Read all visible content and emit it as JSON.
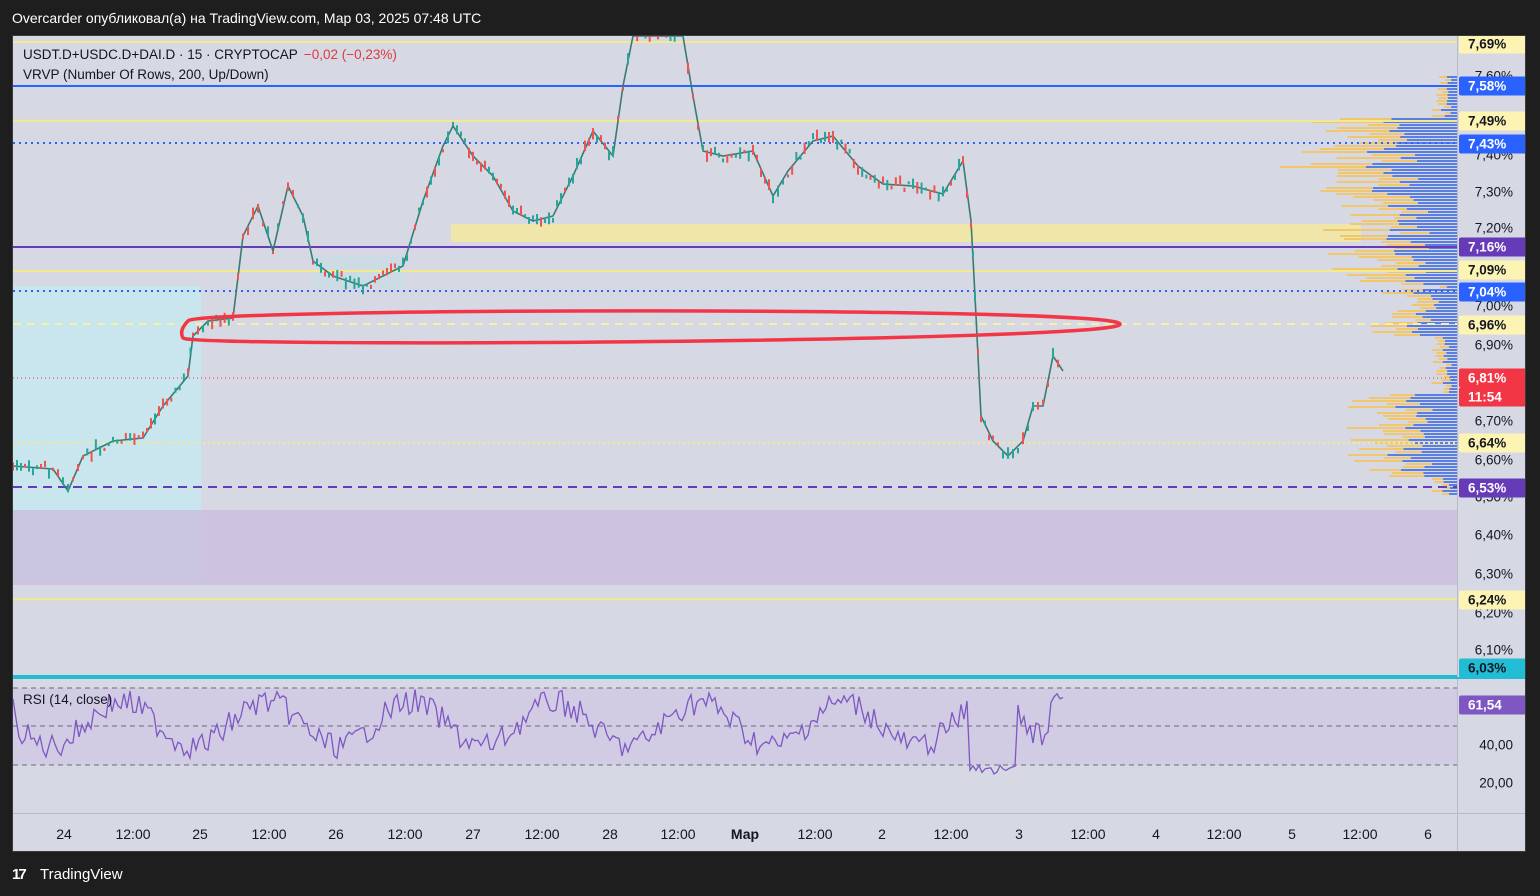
{
  "header": {
    "text": "Overcarder опубликовал(а) на TradingView.com, Мар 03, 2025 07:48 UTC"
  },
  "legend": {
    "symbol": "USDT.D+USDC.D+DAI.D · 15 · CRYPTOCAP",
    "change": "−0,02 (−0,23%)",
    "indicator": "VRVP (Number Of Rows, 200, Up/Down)"
  },
  "rsi": {
    "legend": "RSI (14, close)",
    "value": "61,54",
    "levels": [
      70,
      50,
      30
    ],
    "axis_ticks": [
      "40,00",
      "20,00"
    ]
  },
  "price_axis": {
    "ticks": [
      "7,60%",
      "7,50%",
      "7,40%",
      "7,30%",
      "7,20%",
      "7,00%",
      "6,90%",
      "6,70%",
      "6,60%",
      "6,50%",
      "6,40%",
      "6,30%",
      "6,20%",
      "6,10%"
    ],
    "tags": [
      {
        "label": "7,69%",
        "color": "#fdf4b3",
        "text_color": "#131722"
      },
      {
        "label": "7,58%",
        "color": "#2962ff",
        "text_color": "#ffffff"
      },
      {
        "label": "7,49%",
        "color": "#fdf4b3",
        "text_color": "#131722"
      },
      {
        "label": "7,43%",
        "color": "#2962ff",
        "text_color": "#ffffff"
      },
      {
        "label": "7,16%",
        "color": "#673ab7",
        "text_color": "#ffffff"
      },
      {
        "label": "7,09%",
        "color": "#fdf4b3",
        "text_color": "#131722"
      },
      {
        "label": "7,04%",
        "color": "#2962ff",
        "text_color": "#ffffff"
      },
      {
        "label": "6,96%",
        "color": "#fdf4b3",
        "text_color": "#131722"
      },
      {
        "label": "6,81%",
        "color": "#f23645",
        "text_color": "#ffffff"
      },
      {
        "label": "11:54",
        "color": "#f23645",
        "text_color": "#ffffff"
      },
      {
        "label": "6,64%",
        "color": "#fdf4b3",
        "text_color": "#131722"
      },
      {
        "label": "6,53%",
        "color": "#673ab7",
        "text_color": "#ffffff"
      },
      {
        "label": "6,24%",
        "color": "#fdf4b3",
        "text_color": "#131722"
      },
      {
        "label": "6,03%",
        "color": "#22bcd4",
        "text_color": "#131722"
      }
    ],
    "current_price": "6,81%",
    "countdown": "11:54"
  },
  "time_axis": {
    "labels": [
      "24",
      "12:00",
      "25",
      "12:00",
      "26",
      "12:00",
      "27",
      "12:00",
      "28",
      "12:00",
      "Мар",
      "12:00",
      "2",
      "12:00",
      "3",
      "12:00",
      "4",
      "12:00",
      "5",
      "12:00",
      "6"
    ]
  },
  "footer": {
    "logo_text": "TradingView",
    "logo_icon": "tradingview-logo-icon"
  },
  "colors": {
    "up": "#26a69a",
    "down": "#ef5350",
    "rsi_line": "#7e57c2",
    "highlight_ellipse": "#f23645"
  }
}
